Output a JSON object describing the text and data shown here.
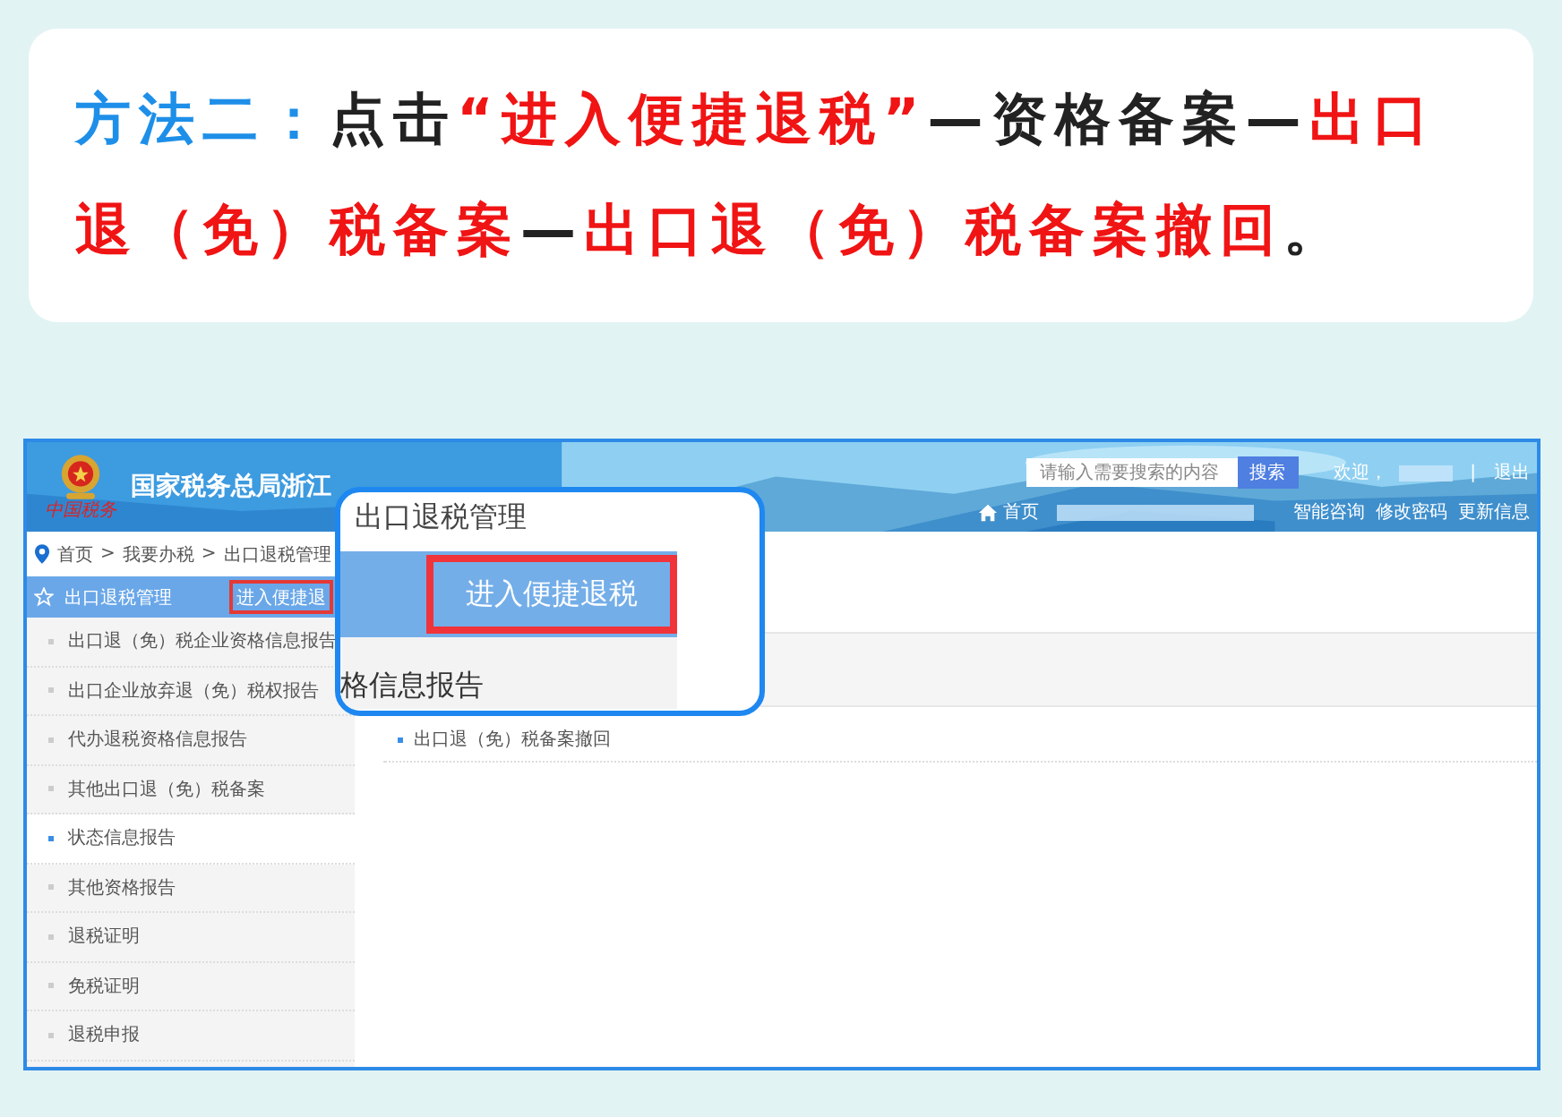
{
  "instruction": {
    "segments": [
      {
        "kind": "lead",
        "text": "方法二："
      },
      {
        "kind": "plain",
        "text": "点击"
      },
      {
        "kind": "highlight",
        "text": "“进入便捷退税”"
      },
      {
        "kind": "plain",
        "text": "—资格备案—"
      },
      {
        "kind": "highlight",
        "text": "出口退（免）税备案"
      },
      {
        "kind": "plain",
        "text": "—"
      },
      {
        "kind": "highlight",
        "text": "出口退（免）税备案撤回"
      },
      {
        "kind": "plain",
        "text": "。"
      }
    ]
  },
  "header": {
    "logo_caption": "中国税务",
    "title": "国家税务总局浙江",
    "search": {
      "placeholder": "请输入需要搜索的内容",
      "button": "搜索"
    },
    "welcome": "欢迎，",
    "separator": "|",
    "logout": "退出",
    "home": "首页",
    "links": [
      "智能咨询",
      "修改密码",
      "更新信息"
    ]
  },
  "breadcrumb": {
    "separator": ">",
    "links": [
      "首页",
      "我要办税",
      "出口退税管理"
    ]
  },
  "sidebar": {
    "title": "出口退税管理",
    "quick_button": "进入便捷退",
    "items": [
      {
        "label": "出口退（免）税企业资格信息报告",
        "selected": false
      },
      {
        "label": "出口企业放弃退（免）税权报告",
        "selected": false
      },
      {
        "label": "代办退税资格信息报告",
        "selected": false
      },
      {
        "label": "其他出口退（免）税备案",
        "selected": false
      },
      {
        "label": "状态信息报告",
        "selected": true
      },
      {
        "label": "其他资格报告",
        "selected": false
      },
      {
        "label": "退税证明",
        "selected": false
      },
      {
        "label": "免税证明",
        "selected": false
      },
      {
        "label": "退税申报",
        "selected": false
      }
    ]
  },
  "content": {
    "items": [
      "出口退（免）税备案撤回"
    ]
  },
  "magnifier": {
    "title": "出口退税管理",
    "button": "进入便捷退税",
    "caption": "格信息报告"
  }
}
